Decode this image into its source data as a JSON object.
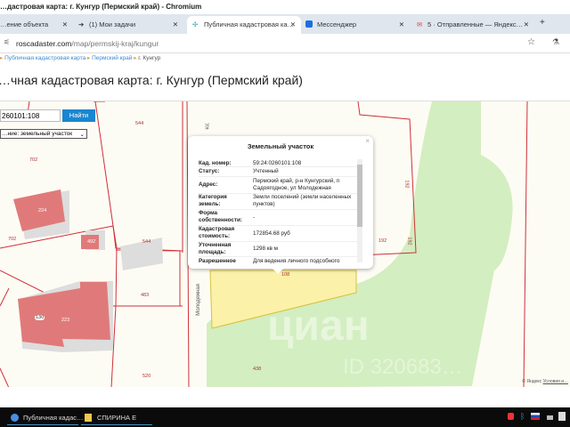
{
  "window": {
    "title": "…дастровая карта: г. Кунгур (Пермский край) - Chromium"
  },
  "tabs": [
    {
      "label": "…ение объекта"
    },
    {
      "label": "(1) Мои задачи"
    },
    {
      "label": "Публичная кадастровая ка…",
      "active": true
    },
    {
      "label": "Мессенджер"
    },
    {
      "label": "5 · Отправленные — Яндекс…"
    }
  ],
  "address": {
    "domain": "roscadaster.com",
    "path": "/map/permskij-kraj/kungur"
  },
  "breadcrumbs": [
    "Публичная кадастровая карта",
    "Пермский край",
    "г. Кунгур"
  ],
  "page": {
    "title": "…чная кадастровая карта: г. Кунгур (Пермский край)"
  },
  "map": {
    "search_value": "260101:108",
    "find_label": "Найти",
    "type_label": "…ние:",
    "type_value": "земельный участок",
    "labels": [
      "544",
      "702",
      "224",
      "702",
      "492",
      "544",
      "483",
      "130",
      "223",
      "520",
      "192",
      "192",
      "192",
      "438",
      "108"
    ],
    "streets": [
      "Молодежная",
      "Ул"
    ],
    "attribution": "© Яндекс",
    "terms": "Условия и…",
    "watermark": "циан",
    "watermark_id": "ID 320683…"
  },
  "popup": {
    "title": "Земельный участок",
    "rows": [
      {
        "k": "Кад. номер:",
        "v": "59:24:0260101:108"
      },
      {
        "k": "Статус:",
        "v": "Учтенный"
      },
      {
        "k": "Адрес:",
        "v": "Пермский край, р-н Кунгурский, п Садоягодное, ул Молодежная"
      },
      {
        "k": "Категория земель:",
        "v": "Земли поселений (земли населенных пунктов)"
      },
      {
        "k": "Форма собственности:",
        "v": "-"
      },
      {
        "k": "Кадастровая стоимость:",
        "v": "172854.68 руб"
      },
      {
        "k": "Уточненная площадь:",
        "v": "1298 кв м"
      },
      {
        "k": "Разрешенное",
        "v": "Для ведения личного подсобного"
      }
    ]
  },
  "taskbar": {
    "items": [
      "Публичная кадас…",
      "СПИРИНА Е"
    ]
  },
  "colors": {
    "accent": "#1a86d0",
    "parcel_line": "#d0303a",
    "building": "#e07a7a",
    "forest": "#d3eec0",
    "selected": "#fbf1a8"
  }
}
